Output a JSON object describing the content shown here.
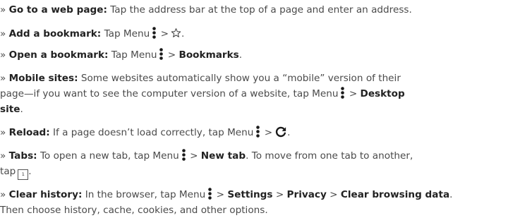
{
  "bullet": "»",
  "tips": [
    {
      "title": "Go to a web page:",
      "text": "Tap the address bar at the top of a page and enter an address."
    },
    {
      "title": "Add a bookmark:",
      "text_before": "Tap Menu",
      "sep": ">",
      "icon_after": "star-outline-icon"
    },
    {
      "title": "Open a bookmark:",
      "text_before": "Tap Menu",
      "sep": ">",
      "bold_after": "Bookmarks",
      "end": "."
    },
    {
      "title": "Mobile sites:",
      "text_line1": "Some websites automatically show you a “mobile” version of their",
      "text_line2_before": "page—if you want to see the computer version of a website, tap Menu",
      "sep": ">",
      "bold_after_line2": "Desktop",
      "bold_line3": "site",
      "end": "."
    },
    {
      "title": "Reload:",
      "text_before": "If a page doesn’t load correctly, tap Menu",
      "sep": ">",
      "icon_after": "reload-icon",
      "end": "."
    },
    {
      "title": "Tabs:",
      "text_before": "To open a new tab, tap Menu",
      "sep": ">",
      "bold_after": "New tab",
      "text_after": ". To move from one tab to another,",
      "text_line2": "tap",
      "tab_count": "1",
      "end": "."
    },
    {
      "title": "Clear history:",
      "text_before": "In the browser, tap Menu",
      "sep": ">",
      "bold_settings": "Settings",
      "bold_privacy": "Privacy",
      "bold_clear": "Clear browsing data",
      "end": ".",
      "text_line2": "Then choose history, cache, cookies, and other options."
    }
  ],
  "colors": {
    "text": "#4a4a4a",
    "bold": "#222222",
    "icon": "#1a1a1a"
  }
}
